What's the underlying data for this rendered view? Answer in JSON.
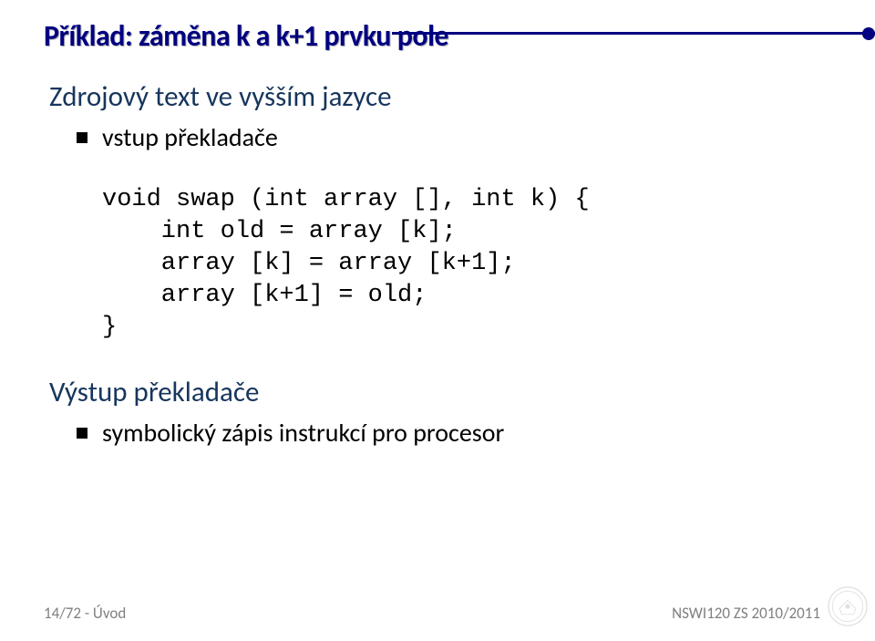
{
  "title": "Příklad: záměna  k a k+1 prvku pole",
  "section1": {
    "heading": "Zdrojový text ve vyšším jazyce",
    "bullet": "vstup překladače"
  },
  "code": {
    "l1": "void swap (int array [], int k) {",
    "l2": "    int old = array [k];",
    "l3": "    array [k] = array [k+1];",
    "l4": "    array [k+1] = old;",
    "l5": "}"
  },
  "section2": {
    "heading": "Výstup překladače",
    "bullet": "symbolický zápis instrukcí pro procesor"
  },
  "footer": {
    "left": "14/72 - Úvod",
    "right": "NSWI120 ZS 2010/2011"
  }
}
